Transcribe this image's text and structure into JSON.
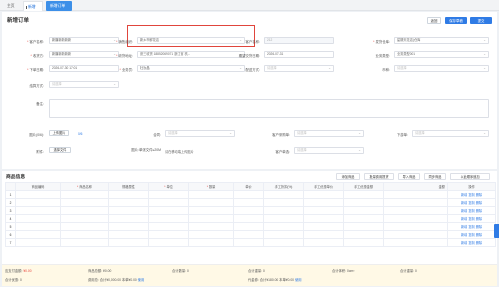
{
  "tabs": [
    {
      "label": "主页"
    },
    {
      "label": "新增订单"
    },
    {
      "label": "新增订单"
    }
  ],
  "page": {
    "title": "新增订单"
  },
  "header_buttons": {
    "back": "返回",
    "save": "保存草稿",
    "submit": "提交"
  },
  "form": {
    "customer": {
      "label": "客户名称:",
      "value": "新疆新新新新"
    },
    "sales_org": {
      "label": "销售组织:",
      "value": "新乡市鲜花店"
    },
    "customer_no": {
      "label": "客户名称:",
      "value": "212"
    },
    "ship_org": {
      "label": "发货仓库:",
      "value": "星期天花店(仓库"
    },
    "delivery_method": {
      "label": "收货方:",
      "value": "新疆新新新新"
    },
    "receive_address": {
      "label": "收货地址:",
      "value": "张三收货 18852069071 浙江省 杭..."
    },
    "delivery_date": {
      "label": "期望交货日期:",
      "value": "2026-07-31"
    },
    "business_type": {
      "label": "业务类型:",
      "value": "业务类型001"
    },
    "order_date": {
      "label": "下单日期:",
      "value": "2026-07-30 17:01"
    },
    "salesman": {
      "label": "业务员:",
      "value": "杜汝晶"
    },
    "dispatch_method": {
      "label": "配送方式:",
      "value": "请选择"
    },
    "currency": {
      "label": "币种:",
      "value": "请选择"
    },
    "settlement": {
      "label": "结算方式:",
      "value": "请选择"
    },
    "remark": {
      "label": "备注:"
    },
    "image": {
      "label": "图片(0/6):",
      "upload": "上传图片",
      "count": "0/6"
    },
    "contract": {
      "label": "合同:",
      "value": "请选择"
    },
    "customer_po": {
      "label": "客户采购单:",
      "value": "请选择"
    },
    "downstream": {
      "label": "下游单:",
      "value": "请选择"
    },
    "attachment": {
      "label": "附件:",
      "upload": "选择文件"
    },
    "image_cap": {
      "label": "图片:单张文件≤20M",
      "hint": "请在移动端上传图片"
    },
    "customer_alt": {
      "label": "客户单选:",
      "value": "请选择"
    }
  },
  "product_section": {
    "title": "商品信息",
    "buttons": [
      "添加商品",
      "批量费用提货",
      "导入商品",
      "同步商品",
      "以此顺序追加"
    ],
    "columns": [
      "",
      "商品编码",
      "商品名称",
      "规格属性",
      "单位",
      "数量",
      "单价",
      "手工折扣(%)",
      "手工优惠单价",
      "手工优惠金额",
      "金额",
      "操作"
    ],
    "rows": [
      {
        "no": "1",
        "ops": [
          "新增",
          "复制",
          "删除"
        ]
      },
      {
        "no": "2",
        "ops": [
          "新增",
          "复制",
          "删除"
        ]
      },
      {
        "no": "3",
        "ops": [
          "新增",
          "复制",
          "删除"
        ]
      },
      {
        "no": "4",
        "ops": [
          "新增",
          "复制",
          "删除"
        ]
      },
      {
        "no": "5",
        "ops": [
          "新增",
          "复制",
          "删除"
        ]
      },
      {
        "no": "6",
        "ops": [
          "新增",
          "复制",
          "删除"
        ]
      },
      {
        "no": "7",
        "ops": [
          "新增",
          "复制",
          "删除"
        ]
      }
    ]
  },
  "footer": {
    "total_payable_label": "应支付金额:",
    "total_payable_value": "¥0.00",
    "product_total_label": "商品总额:",
    "product_total_value": "¥0.00",
    "total_qty_label": "合计数量:",
    "total_qty_value": "0",
    "total_weight_label": "合计重量:",
    "total_weight_value": "0",
    "total_volume_label": "合计体积:",
    "total_volume_value": "0cm³",
    "total_amount_label": "合计重量:",
    "total_amount_value": "0",
    "order_discount_label": "合计优惠:",
    "order_discount_value": "0",
    "fee_label": "费用总:",
    "fee_value": "合计¥0,000.00 本单¥0.00",
    "fee_link": "使用",
    "coupon_label": "代金券:",
    "coupon_value": "合计¥180.00 本单¥0.00",
    "coupon_link": "使用"
  }
}
